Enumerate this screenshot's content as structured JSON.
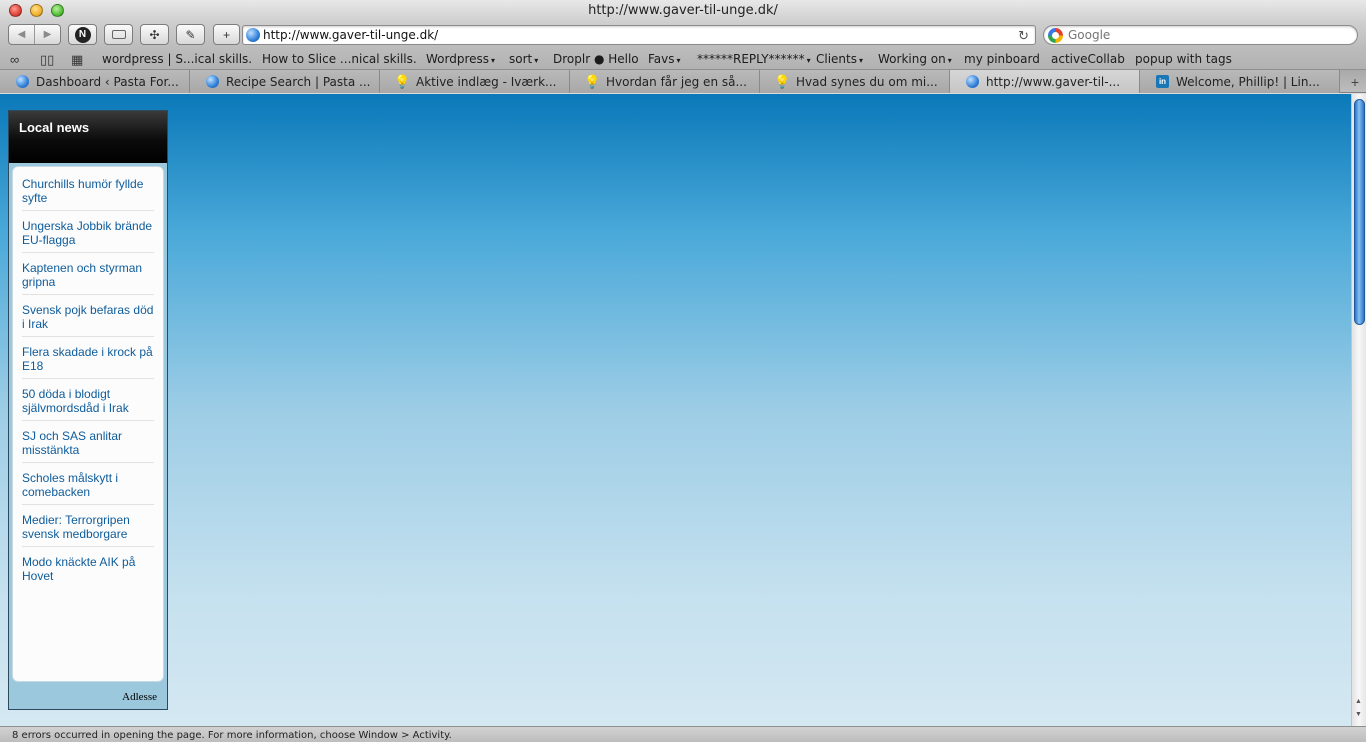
{
  "window": {
    "title": "http://www.gaver-til-unge.dk/"
  },
  "toolbar": {
    "url": "http://www.gaver-til-unge.dk/",
    "search_placeholder": "Google",
    "reload_glyph": "↻",
    "add_glyph": "+",
    "n_glyph": "N"
  },
  "bookmarks": [
    {
      "label": "wordpress | S...ical skills.",
      "arrow": ""
    },
    {
      "label": "How to Slice ...nical skills.",
      "arrow": ""
    },
    {
      "label": "Wordpress",
      "arrow": "▾"
    },
    {
      "label": "sort",
      "arrow": "▾"
    },
    {
      "label": "Droplr ● Hello",
      "arrow": ""
    },
    {
      "label": "Favs",
      "arrow": "▾"
    },
    {
      "label": "******REPLY******",
      "arrow": "▾"
    },
    {
      "label": "Clients",
      "arrow": "▾"
    },
    {
      "label": "Working on",
      "arrow": "▾"
    },
    {
      "label": "my pinboard",
      "arrow": ""
    },
    {
      "label": "activeCollab",
      "arrow": ""
    },
    {
      "label": "popup with tags",
      "arrow": ""
    }
  ],
  "tabs": [
    {
      "label": "Dashboard ‹ Pasta For...",
      "icon": "globe-icon"
    },
    {
      "label": "Recipe Search | Pasta ...",
      "icon": "globe-icon"
    },
    {
      "label": "Aktive indlæg - Iværk...",
      "icon": "lightbulb-icon"
    },
    {
      "label": "Hvordan får jeg en så...",
      "icon": "lightbulb-icon"
    },
    {
      "label": "Hvad synes du om mi...",
      "icon": "lightbulb-icon"
    },
    {
      "label": "http://www.gaver-til-...",
      "icon": "globe-icon"
    },
    {
      "label": "Welcome, Phillip! | Lin...",
      "icon": "linkedin-icon"
    }
  ],
  "widget": {
    "title": "Local news",
    "items": [
      "Churchills humör fyllde syfte",
      "Ungerska Jobbik brände EU-flagga",
      "Kaptenen och styrman gripna",
      "Svensk pojk befaras död i Irak",
      "Flera skadade i krock på E18",
      "50 döda i blodigt självmordsdåd i Irak",
      "SJ och SAS anlitar misstänkta",
      "Scholes målskytt i comebacken",
      "Medier: Terrorgripen svensk medborgare",
      "Modo knäckte AIK på Hovet"
    ],
    "credit": "Adlesse"
  },
  "status": {
    "text": "8 errors occurred in opening the page. For more information, choose Window > Activity."
  },
  "colors": {
    "page_top": "#0a78b9",
    "page_bottom": "#d4e8f2",
    "link": "#0e5c9b"
  }
}
